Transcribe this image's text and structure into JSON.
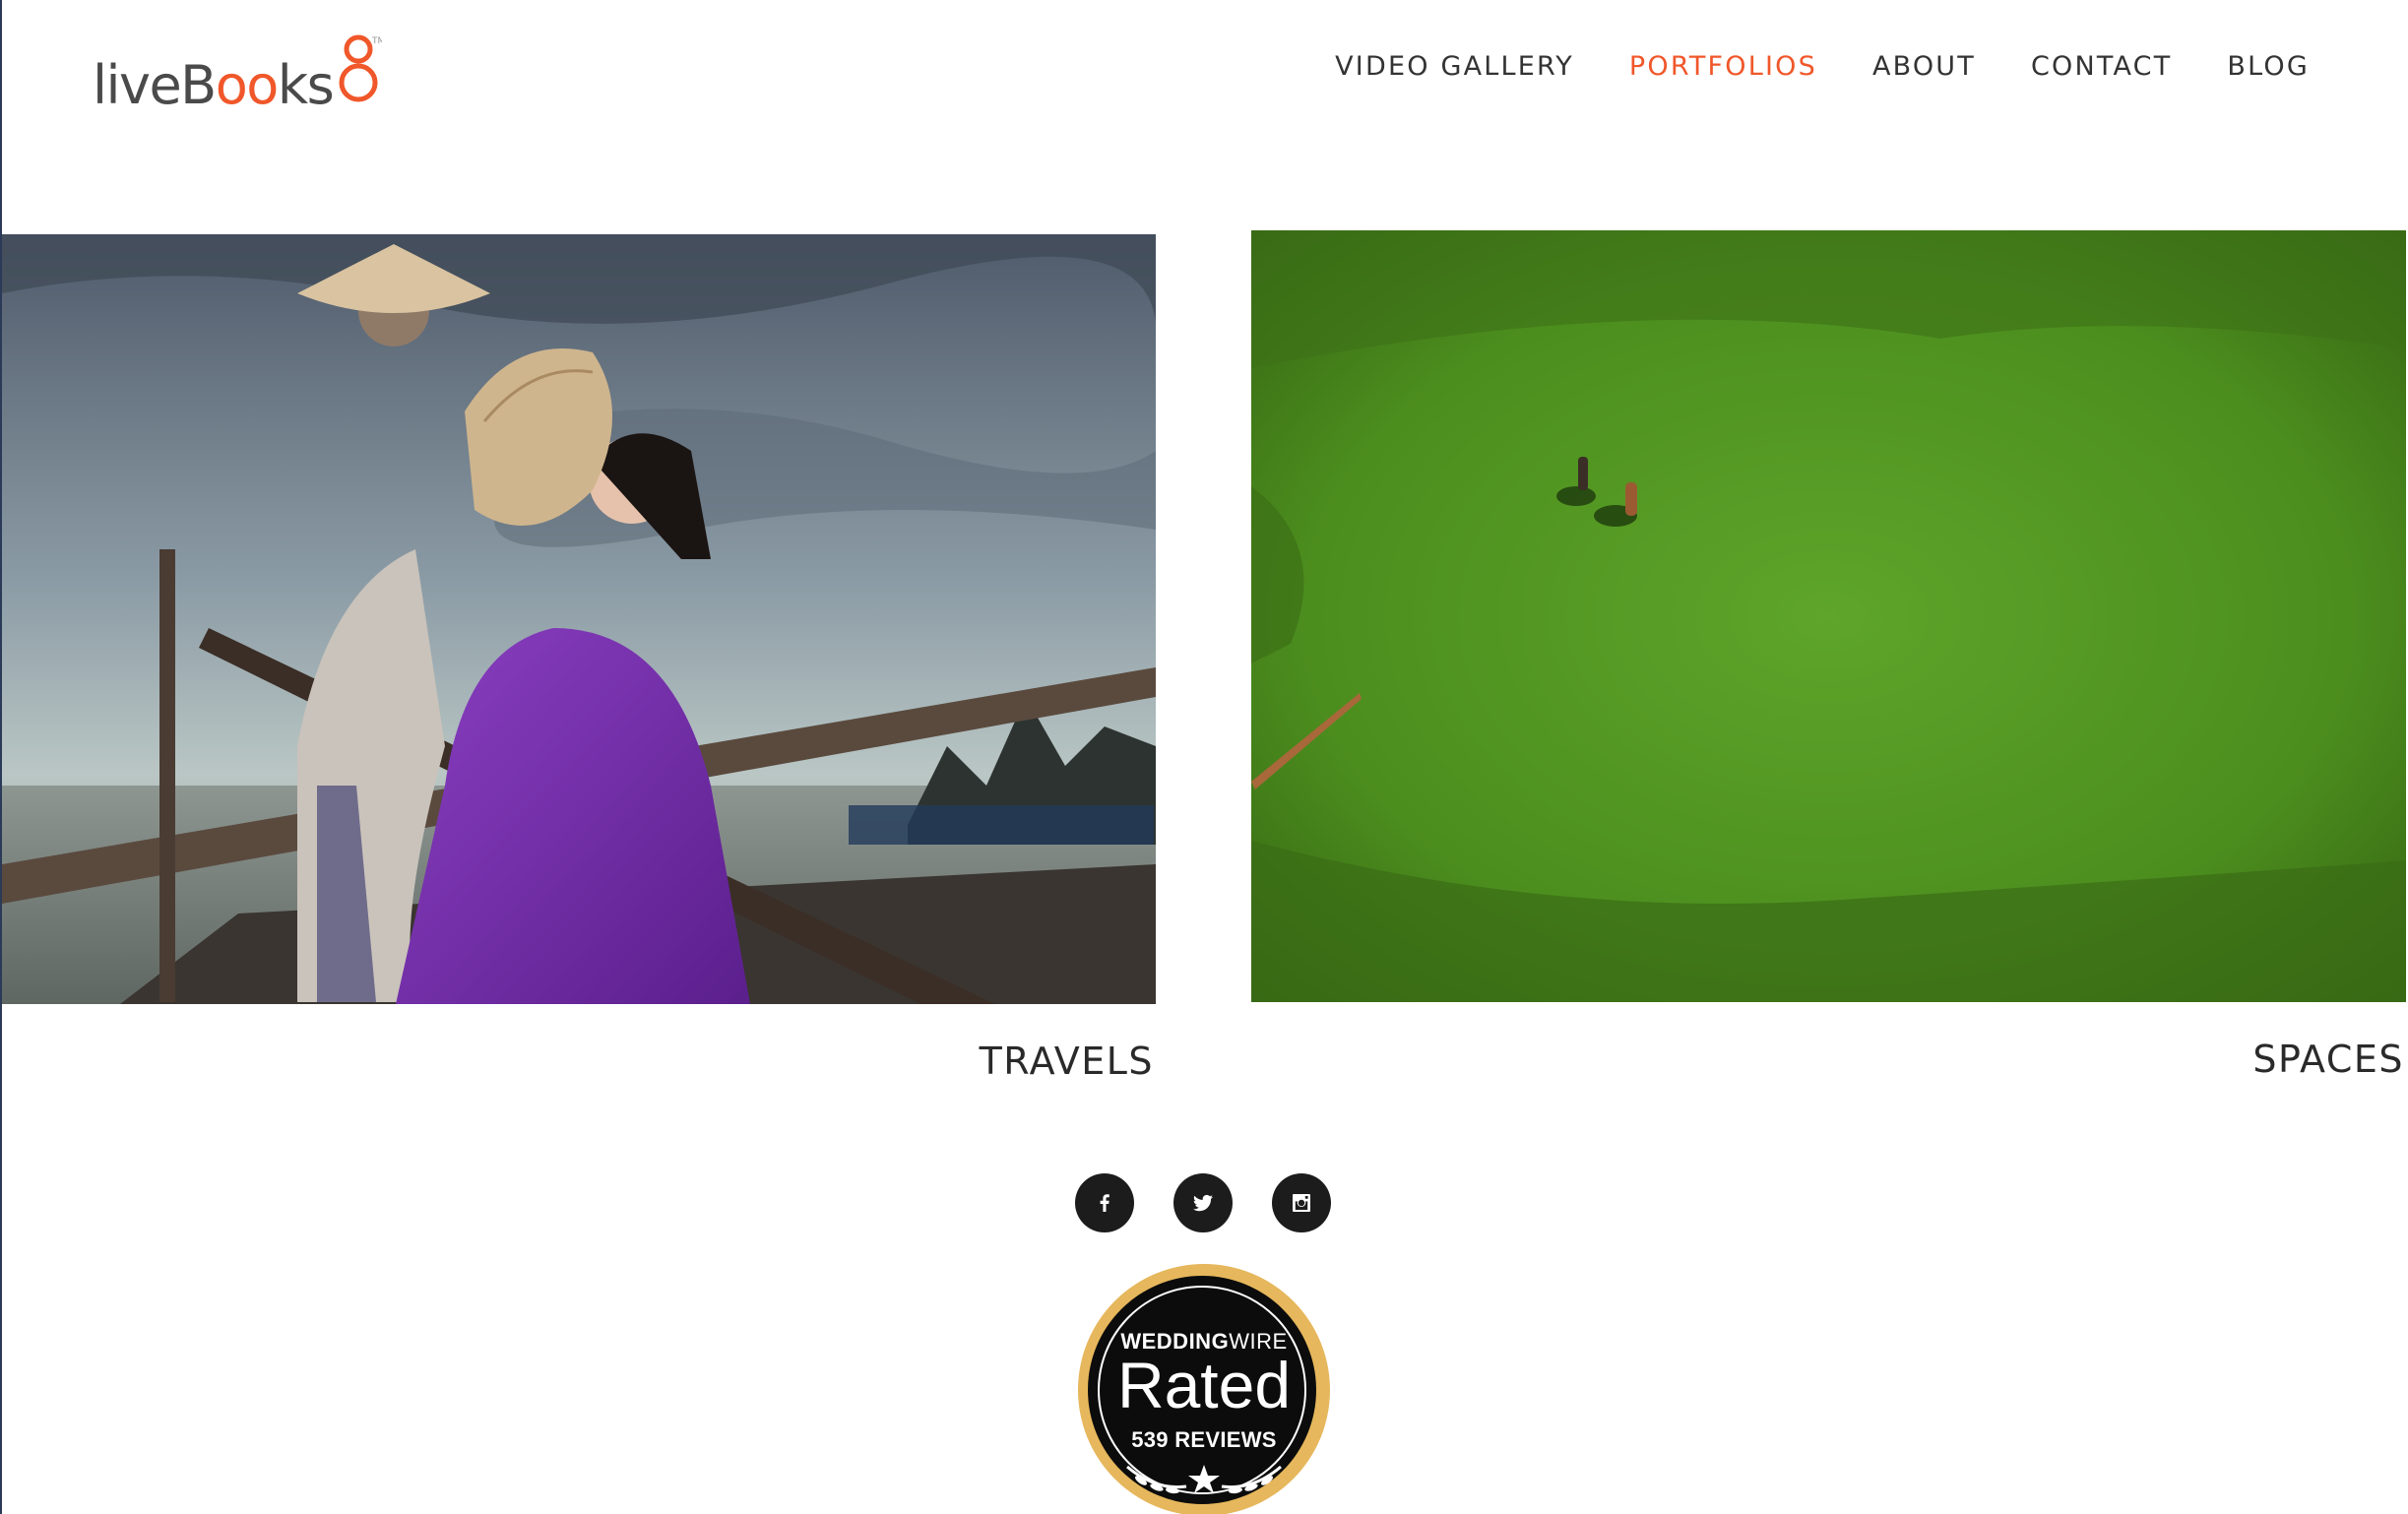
{
  "header": {
    "logo": {
      "text_start": "liveB",
      "text_oo": "oo",
      "text_end": "ks",
      "mark": "8"
    },
    "nav": [
      {
        "label": "VIDEO GALLERY",
        "active": false
      },
      {
        "label": "PORTFOLIOS",
        "active": true
      },
      {
        "label": "ABOUT",
        "active": false
      },
      {
        "label": "CONTACT",
        "active": false
      },
      {
        "label": "BLOG",
        "active": false
      }
    ]
  },
  "portfolios": [
    {
      "label": "TRAVELS",
      "image": "woman-in-purple-ao-dai-on-boat-photo"
    },
    {
      "label": "SPACES",
      "image": "aerial-green-field-with-horses-photo"
    }
  ],
  "social": [
    {
      "icon": "facebook-icon"
    },
    {
      "icon": "twitter-icon"
    },
    {
      "icon": "instagram-icon"
    }
  ],
  "badge": {
    "brand_bold": "WEDDING",
    "brand_light": "WIRE",
    "rated": "Rated",
    "reviews": "539 REVIEWS"
  },
  "colors": {
    "accent": "#f0572a",
    "badge_gold": "#e6b75c",
    "text": "#333333"
  }
}
